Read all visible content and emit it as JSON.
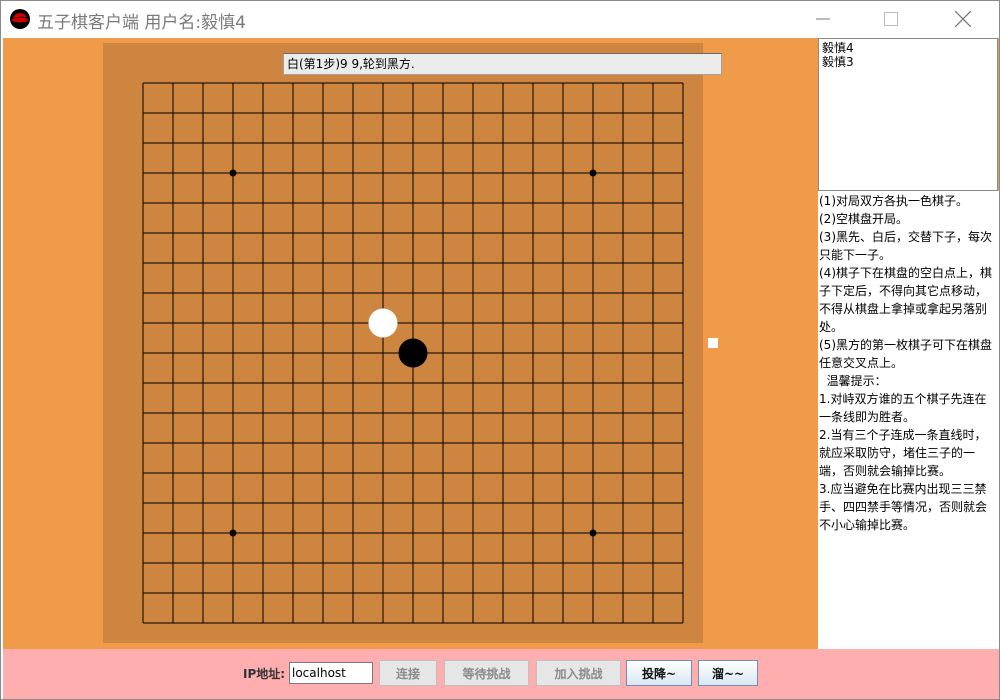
{
  "window": {
    "title": "五子棋客户端 用户名:毅慎4",
    "controls": {
      "minimize_icon": "minimize-icon",
      "maximize_icon": "maximize-icon",
      "close_icon": "close-icon"
    }
  },
  "status": "白(第1步)9 9,轮到黑方.",
  "board": {
    "size": 19,
    "star_points": [
      [
        3,
        3
      ],
      [
        15,
        3
      ],
      [
        3,
        15
      ],
      [
        15,
        15
      ]
    ],
    "stones": [
      {
        "col": 8,
        "row": 8,
        "color": "white"
      },
      {
        "col": 9,
        "row": 9,
        "color": "black"
      }
    ],
    "colors": {
      "outer": "#cd853f",
      "line": "#000000",
      "background": "#f09b4a"
    }
  },
  "users": [
    "毅慎4",
    "毅慎3"
  ],
  "rules": [
    "(1)对局双方各执一色棋子。",
    "(2)空棋盘开局。",
    "(3)黑先、白后，交替下子，每次只能下一子。",
    "(4)棋子下在棋盘的空白点上，棋子下定后，不得向其它点移动，不得从棋盘上拿掉或拿起另落别处。",
    "(5)黑方的第一枚棋子可下在棋盘任意交叉点上。",
    "  温馨提示：",
    "1.对峙双方谁的五个棋子先连在一条线即为胜者。",
    "2.当有三个子连成一条直线时，就应采取防守，堵住三子的一端，否则就会输掉比赛。",
    "3.应当避免在比赛内出现三三禁手、四四禁手等情况，否则就会不小心输掉比赛。"
  ],
  "bottom": {
    "ip_label": "IP地址:",
    "ip_value": "localhost",
    "buttons": {
      "connect": "连接",
      "wait": "等待挑战",
      "join": "加入挑战",
      "surrender": "投降~",
      "escape": "溜~~"
    }
  }
}
